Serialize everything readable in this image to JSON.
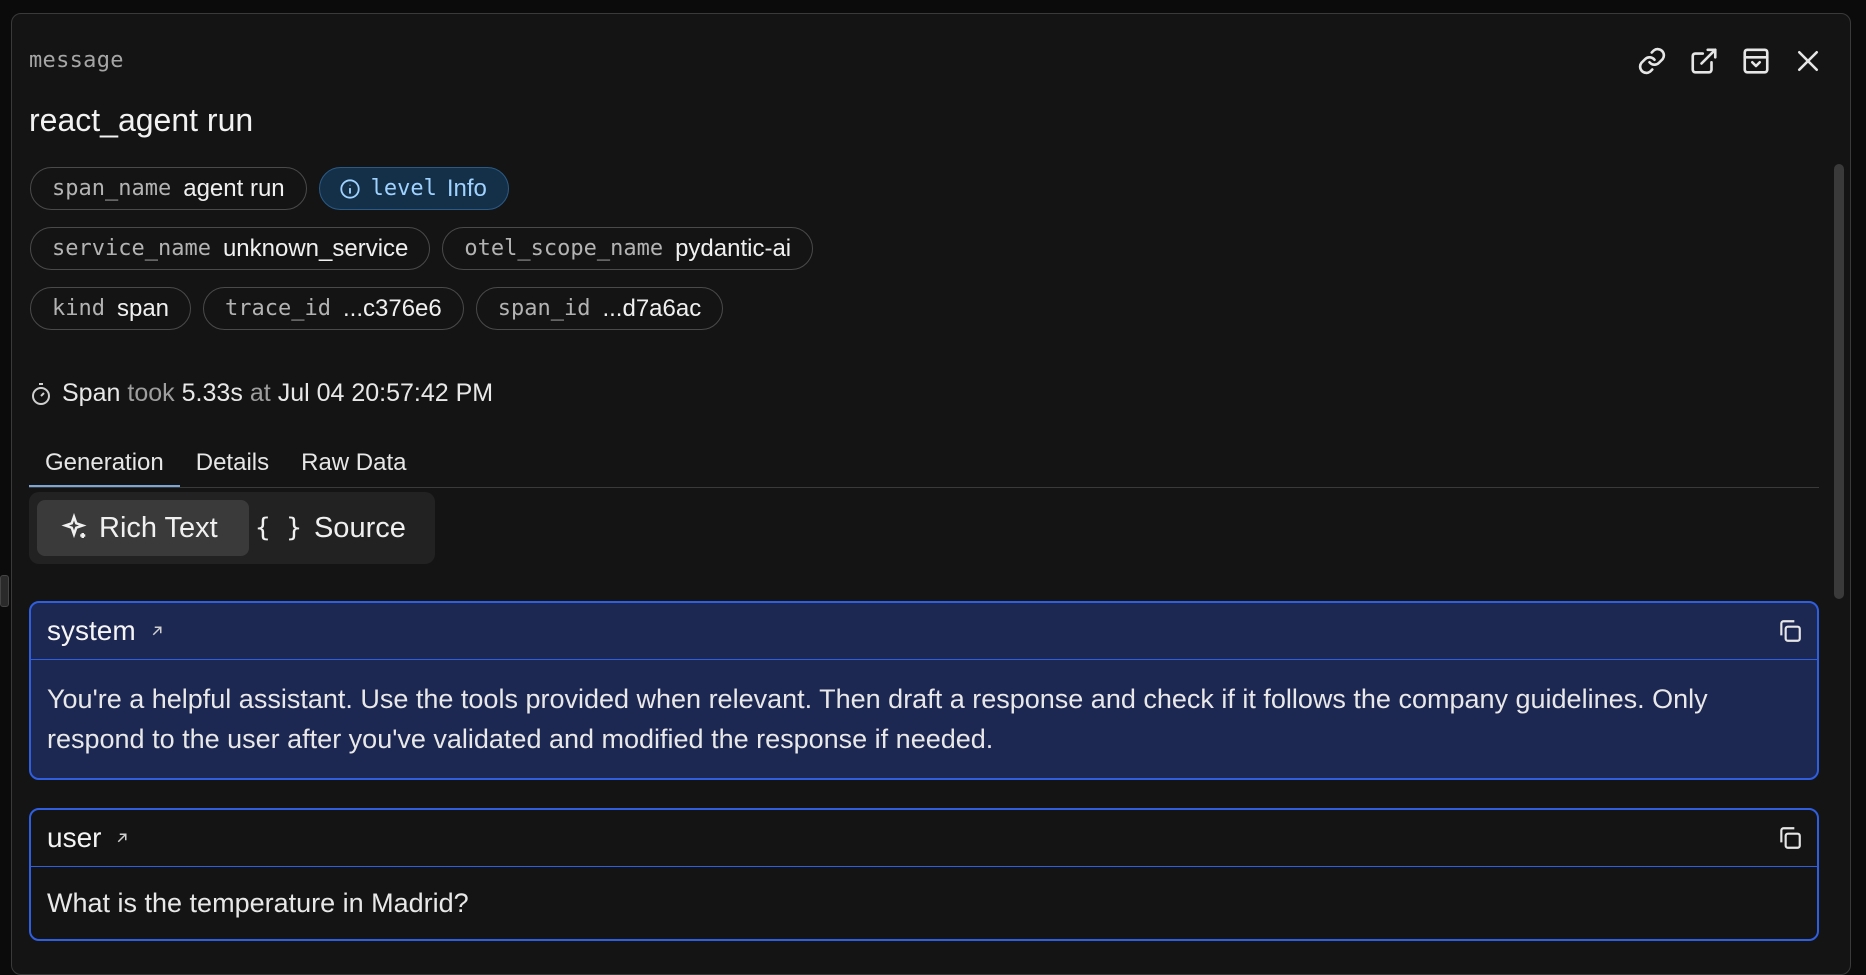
{
  "header": {
    "type_label": "message",
    "title": "react_agent run"
  },
  "icons": {
    "link": "link-icon",
    "external": "external-link-icon",
    "archive": "archive-icon",
    "close": "close-icon",
    "info": "info-icon",
    "stopwatch": "stopwatch-icon",
    "sparkle": "sparkle-icon",
    "copy": "copy-icon",
    "arrow": "arrow-up-right-icon"
  },
  "badges": [
    {
      "key": "span_name",
      "value": "agent run"
    },
    {
      "key": "level",
      "value": "Info"
    },
    {
      "key": "service_name",
      "value": "unknown_service"
    },
    {
      "key": "otel_scope_name",
      "value": "pydantic-ai"
    },
    {
      "key": "kind",
      "value": "span"
    },
    {
      "key": "trace_id",
      "value": "...c376e6"
    },
    {
      "key": "span_id",
      "value": "...d7a6ac"
    }
  ],
  "timing": {
    "span": "Span",
    "took": "took",
    "duration": "5.33s",
    "at": "at",
    "timestamp": "Jul 04 20:57:42 PM"
  },
  "tabs": [
    "Generation",
    "Details",
    "Raw Data"
  ],
  "view_toggle": {
    "rich_text": "Rich Text",
    "source_braces": "{ }",
    "source": "Source"
  },
  "messages": [
    {
      "role": "system",
      "content": "You're a helpful assistant. Use the tools provided when relevant. Then draft a response and check if it follows the company guidelines. Only respond to the user after you've validated and modified the response if needed."
    },
    {
      "role": "user",
      "content": "What is the temperature in Madrid?"
    }
  ],
  "colors": {
    "accent_border": "#2f5ee0",
    "system_bg": "#1c2752",
    "info_badge_bg": "#143049",
    "info_text": "#9fd2ff"
  }
}
